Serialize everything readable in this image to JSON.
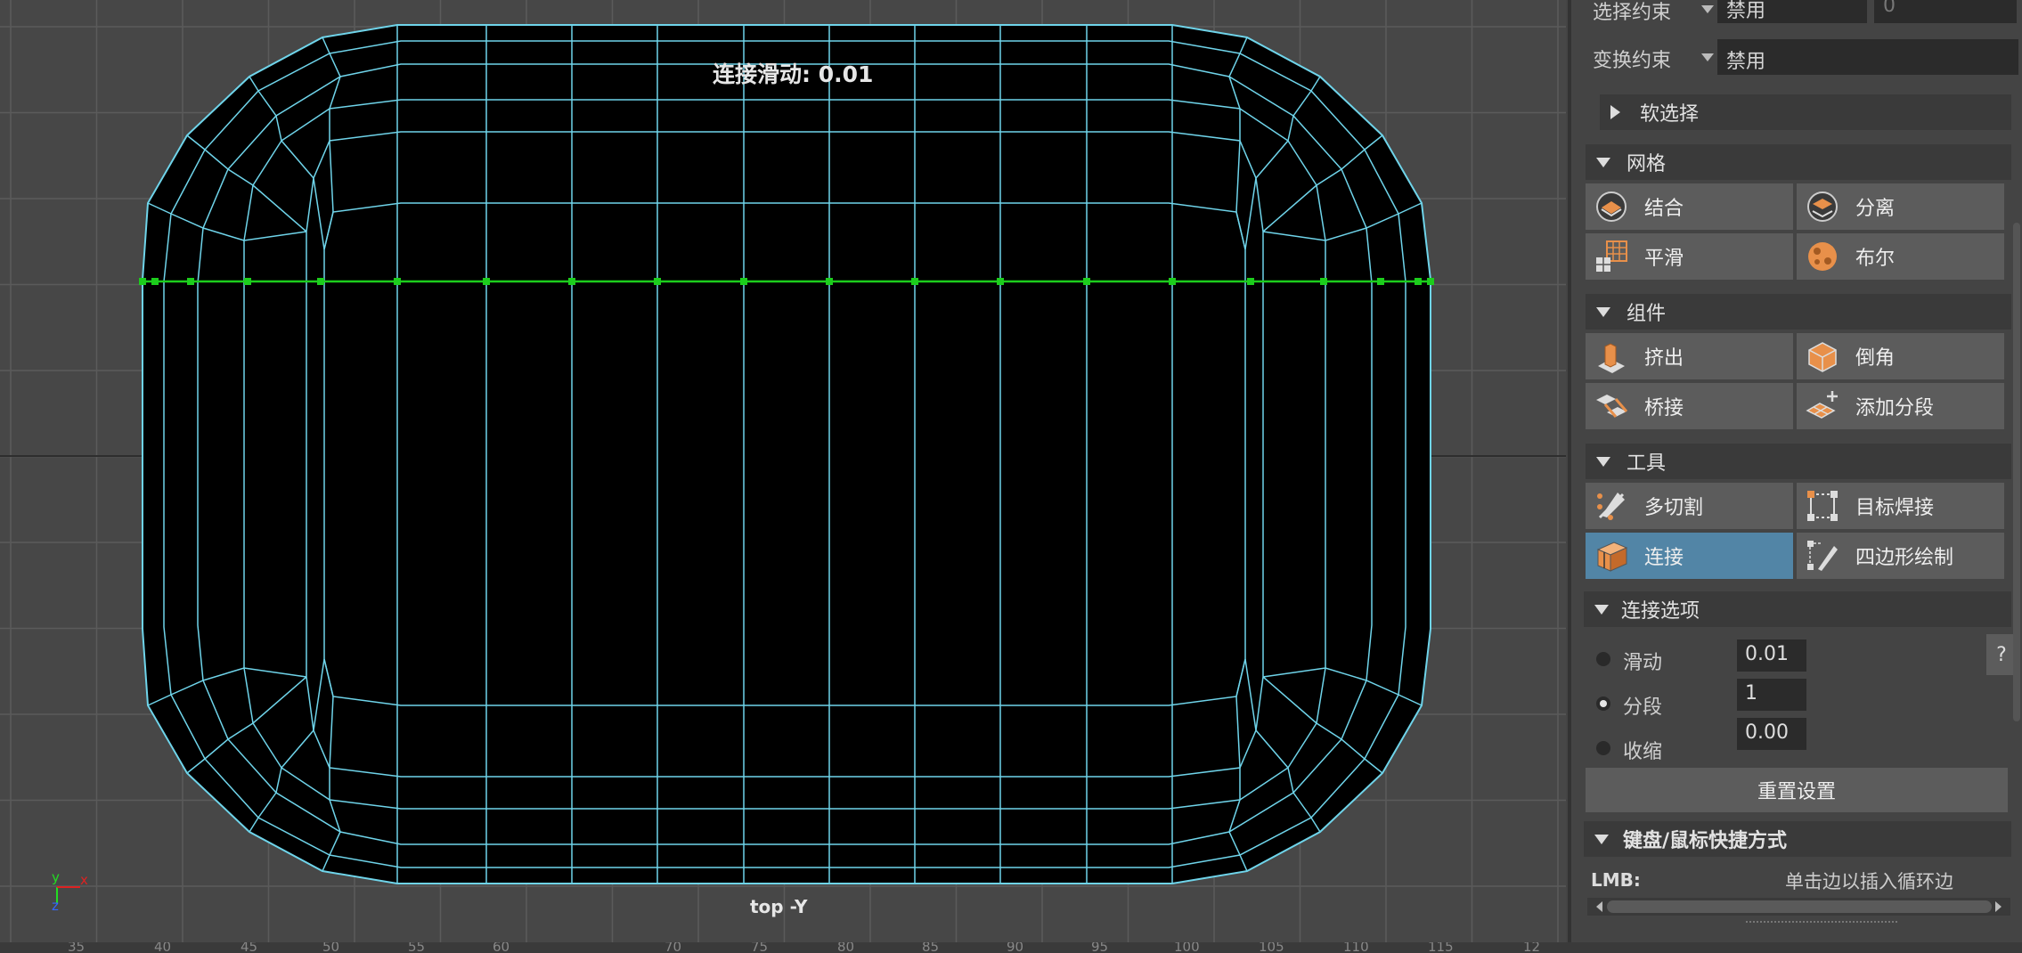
{
  "viewport": {
    "hud_slide": "连接滑动: 0.01",
    "camera_label": "top -Y",
    "axis": {
      "y": "y",
      "x": "x",
      "z": "z"
    },
    "ruler_ticks": [
      "35",
      "40",
      "45",
      "50",
      "55",
      "60",
      "70",
      "75",
      "80",
      "85",
      "90",
      "95",
      "100",
      "105",
      "110",
      "115",
      "12"
    ]
  },
  "panel": {
    "selection_constraint": {
      "label": "选择约束",
      "value": "禁用",
      "extra": "0"
    },
    "transform_constraint": {
      "label": "变换约束",
      "value": "禁用"
    },
    "soft_select": "软选择",
    "mesh": {
      "title": "网格",
      "buttons": [
        "结合",
        "分离",
        "平滑",
        "布尔"
      ]
    },
    "components": {
      "title": "组件",
      "buttons": [
        "挤出",
        "倒角",
        "桥接",
        "添加分段"
      ]
    },
    "tools": {
      "title": "工具",
      "buttons": [
        "多切割",
        "目标焊接",
        "连接",
        "四边形绘制"
      ],
      "active": "连接"
    },
    "connect_options": {
      "title": "连接选项",
      "slide_label": "滑动",
      "slide_value": "0.01",
      "segments_label": "分段",
      "segments_value": "1",
      "pinch_label": "收缩",
      "pinch_value": "0.00",
      "help": "?",
      "reset": "重置设置"
    },
    "shortcuts": {
      "title": "键盘/鼠标快捷方式",
      "lmb_key": "LMB:",
      "lmb_desc": "单击边以插入循环边"
    }
  },
  "colors": {
    "wire": "#6fd4ea",
    "selection": "#1ccd1c",
    "active_tool": "#5285a6",
    "mesh_fill": "#000000",
    "grid": "#5a5a5a"
  }
}
